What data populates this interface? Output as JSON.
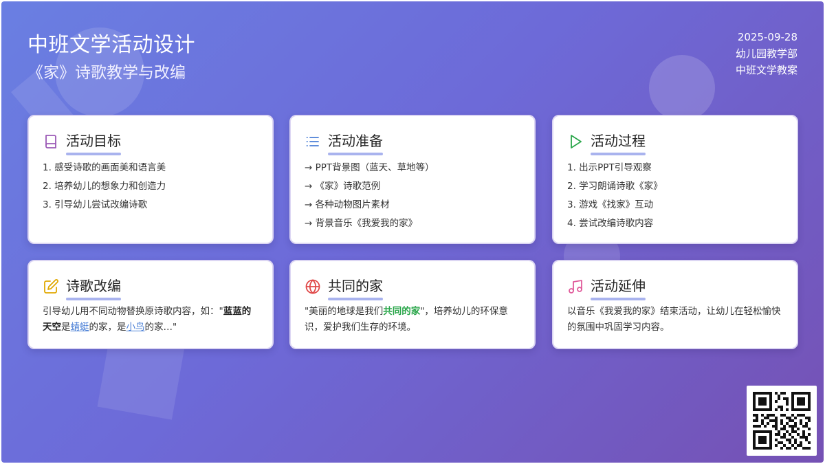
{
  "header": {
    "title": "中班文学活动设计",
    "subtitle": "《家》诗歌教学与改编",
    "date": "2025-09-28",
    "department": "幼儿园教学部",
    "doc_type": "中班文学教案"
  },
  "colors": {
    "bg_start": "#6a7fe2",
    "bg_end": "#7551b4",
    "underline": "#a9b3ee",
    "icon_goal": "#9b59b6",
    "icon_prep": "#4a7fd6",
    "icon_process": "#2aa64a",
    "icon_adapt": "#e0a800",
    "icon_home": "#e04848",
    "icon_extend": "#e05a9a"
  },
  "cards": {
    "goal": {
      "icon": "book-icon",
      "title": "活动目标",
      "items": [
        "1. 感受诗歌的画面美和语言美",
        "2. 培养幼儿的想象力和创造力",
        "3. 引导幼儿尝试改编诗歌"
      ]
    },
    "prep": {
      "icon": "list-icon",
      "title": "活动准备",
      "items": [
        "→ PPT背景图（蓝天、草地等）",
        "→ 《家》诗歌范例",
        "→ 各种动物图片素材",
        "→ 背景音乐《我爱我的家》"
      ]
    },
    "process": {
      "icon": "play-icon",
      "title": "活动过程",
      "items": [
        "1. 出示PPT引导观察",
        "2. 学习朗诵诗歌《家》",
        "3. 游戏《找家》互动",
        "4. 尝试改编诗歌内容"
      ]
    },
    "adapt": {
      "icon": "edit-icon",
      "title": "诗歌改编",
      "text_a": "引导幼儿用不同动物替换原诗歌内容，如：\"",
      "text_b": "蓝蓝的天空",
      "text_c": "是",
      "text_d": "蜻蜓",
      "text_e": "的家，是",
      "text_f": "小鸟",
      "text_g": "的家…\""
    },
    "home": {
      "icon": "globe-icon",
      "title": "共同的家",
      "text_a": "\"美丽的地球是我们",
      "text_b": "共同的家",
      "text_c": "\"，培养幼儿的环保意识，爱护我们生存的环境。"
    },
    "extend": {
      "icon": "music-icon",
      "title": "活动延伸",
      "text": "以音乐《我爱我的家》结束活动，让幼儿在轻松愉快的氛围中巩固学习内容。"
    }
  },
  "qr": {
    "icon": "qr-code-icon"
  }
}
